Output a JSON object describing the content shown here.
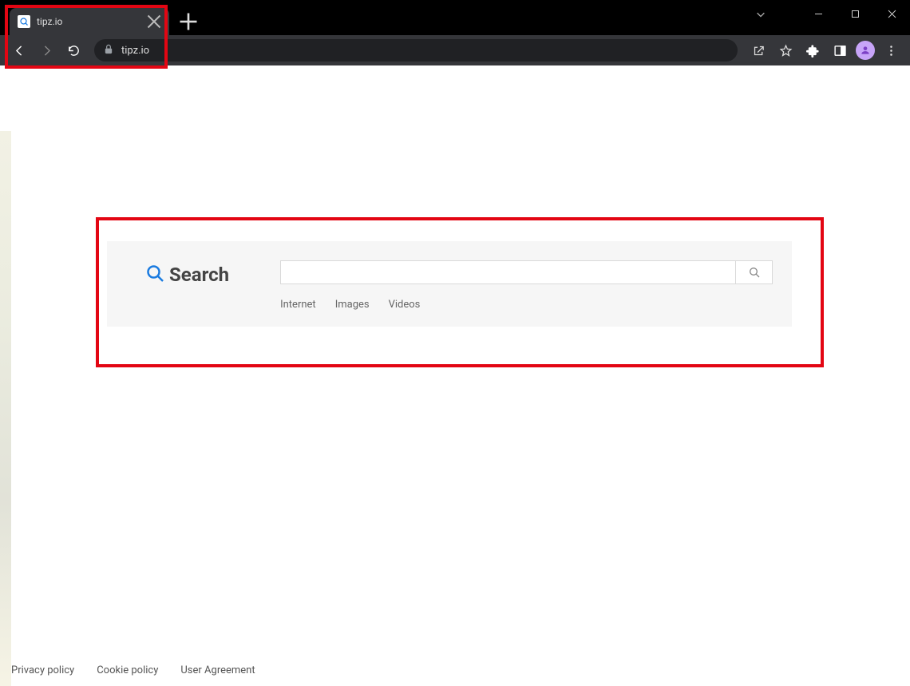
{
  "browser": {
    "tab_title": "tipz.io",
    "url": "tipz.io"
  },
  "search": {
    "logo_text": "Search",
    "input_value": "",
    "tabs": [
      "Internet",
      "Images",
      "Videos"
    ]
  },
  "footer": {
    "links": [
      "Privacy policy",
      "Cookie policy",
      "User Agreement"
    ]
  }
}
